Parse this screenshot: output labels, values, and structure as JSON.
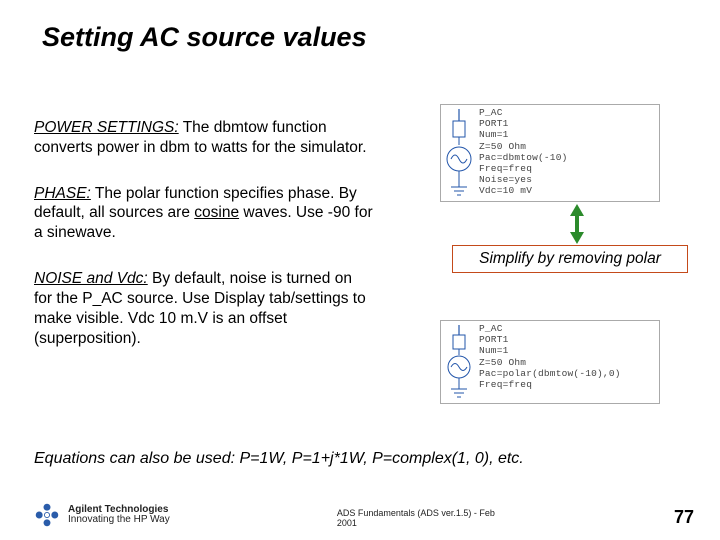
{
  "title": "Setting AC source values",
  "paras": {
    "power": {
      "label": "POWER SETTINGS:",
      "text": " The dbmtow function converts power in dbm to watts for the simulator."
    },
    "phase": {
      "label": "PHASE:",
      "text": " The polar function specifies phase. By default, all sources are ",
      "cosine": "cosine",
      "tail": " waves. Use -90 for a sinewave."
    },
    "noise": {
      "label": "NOISE and Vdc:",
      "text": " By default, noise is turned on for the P_AC source. Use Display tab/settings to make visible. Vdc 10 m.V is an offset (superposition)."
    }
  },
  "diagram1": {
    "l1": "P_AC",
    "l2": "PORT1",
    "l3": "Num=1",
    "l4": "Z=50 Ohm",
    "l5": "Pac=dbmtow(-10)",
    "l6": "Freq=freq",
    "l7": "Noise=yes",
    "l8": "Vdc=10 mV"
  },
  "callout": "Simplify by removing polar",
  "diagram2": {
    "l1": "P_AC",
    "l2": "PORT1",
    "l3": "Num=1",
    "l4": "Z=50 Ohm",
    "l5": "Pac=polar(dbmtow(-10),0)",
    "l6": "Freq=freq"
  },
  "equations": "Equations can also be used: P=1W, P=1+j*1W, P=complex(1, 0), etc.",
  "footer": {
    "brand": "Agilent Technologies",
    "tagline": "Innovating the HP Way",
    "course": "ADS Fundamentals (ADS ver.1.5) - Feb 2001",
    "page": "77"
  }
}
